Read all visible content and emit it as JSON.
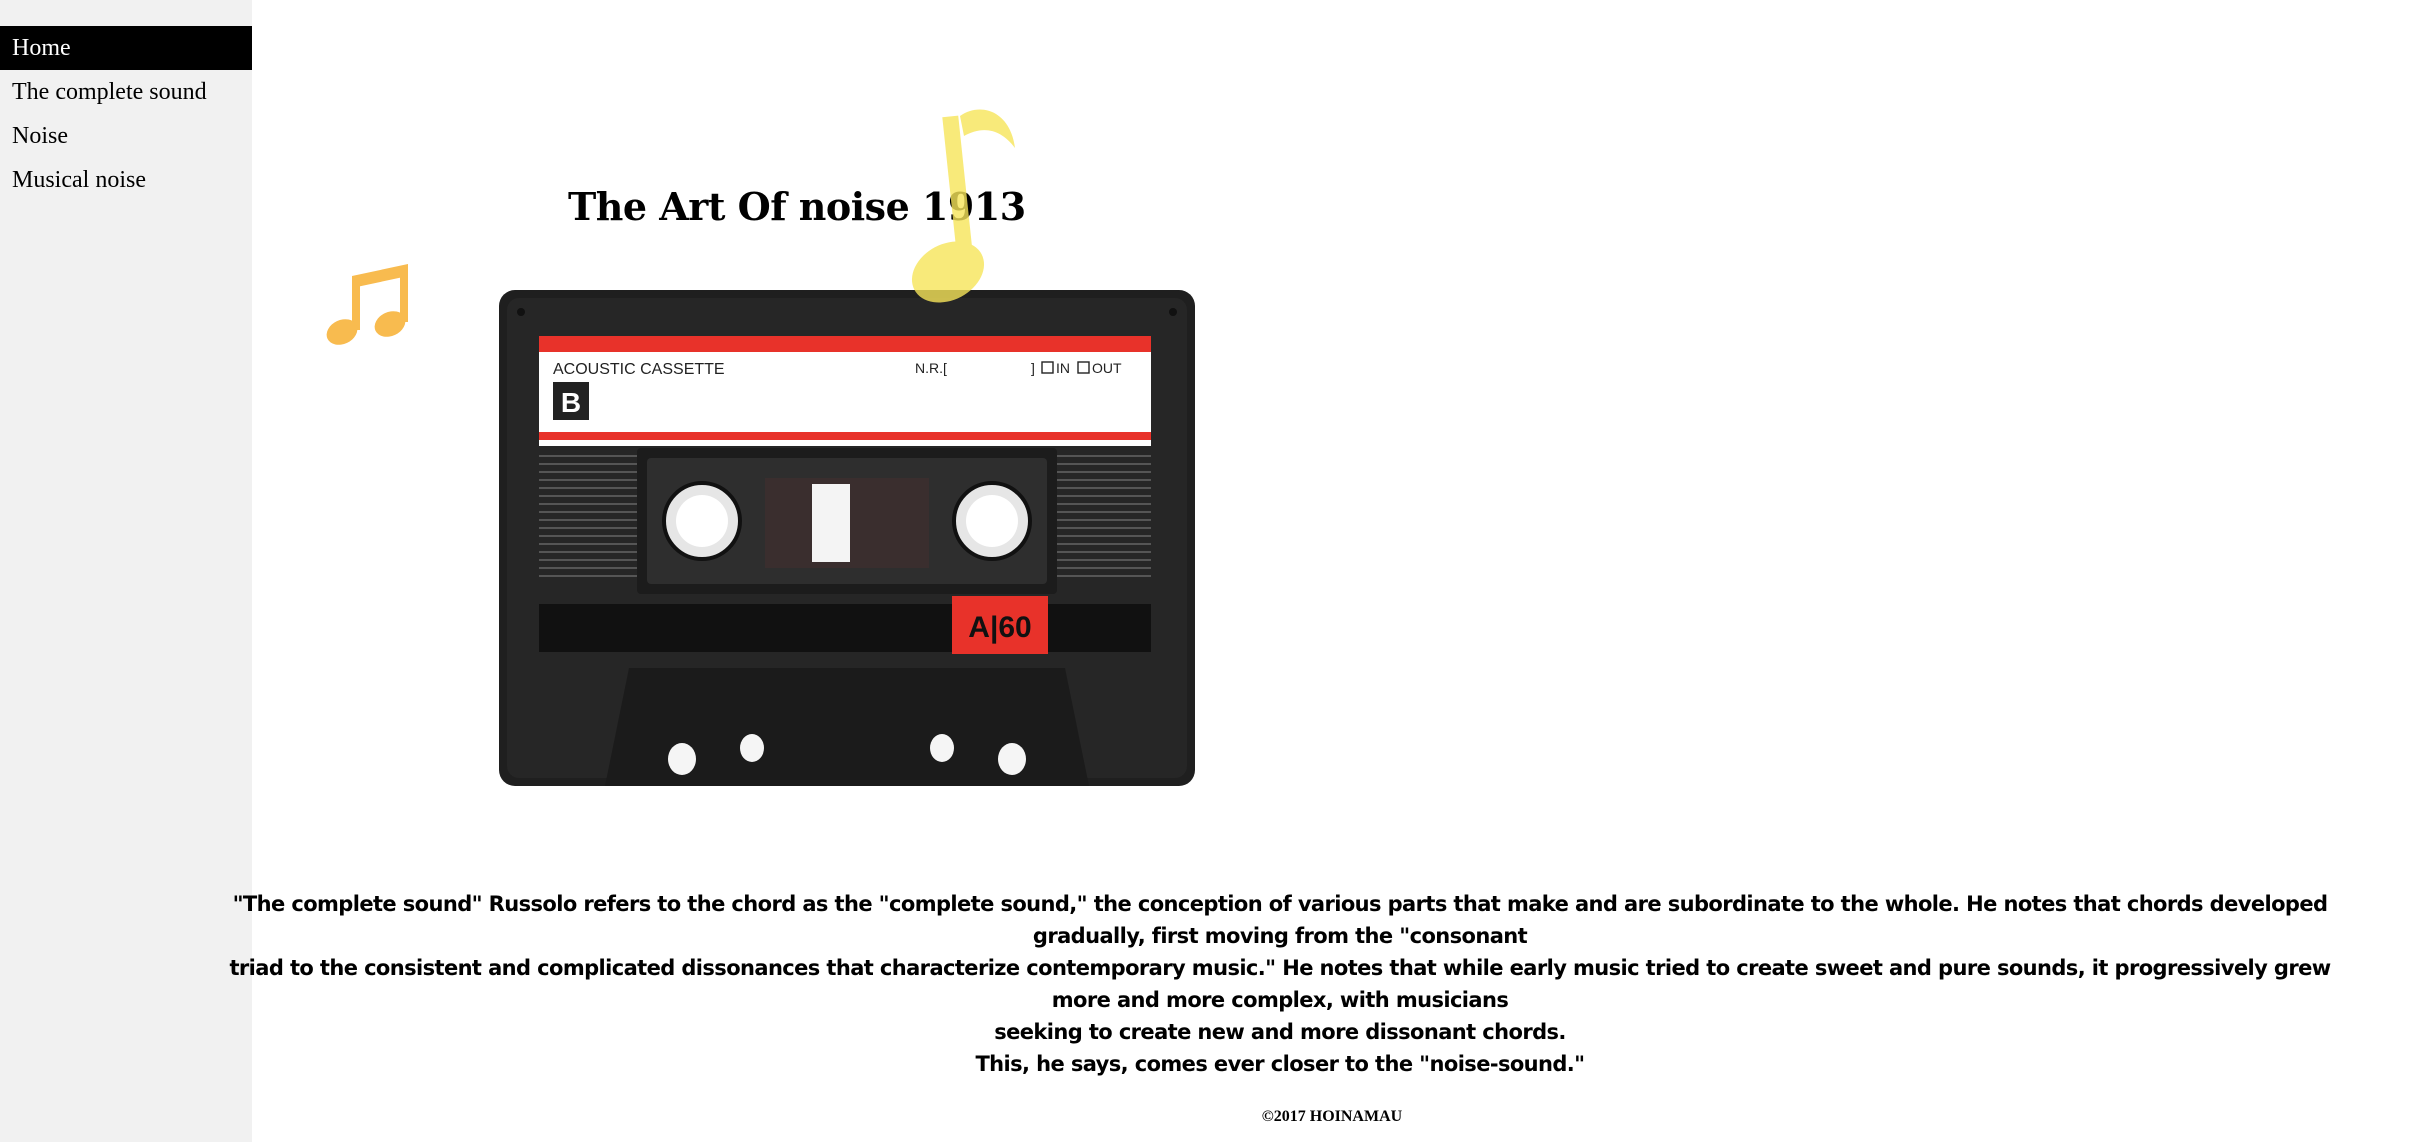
{
  "nav": {
    "items": [
      {
        "label": "Home",
        "active": true
      },
      {
        "label": "The complete sound",
        "active": false
      },
      {
        "label": "Noise",
        "active": false
      },
      {
        "label": "Musical noise",
        "active": false
      }
    ]
  },
  "main": {
    "title": "The Art Of noise 1913",
    "cassette": {
      "brand_text": "ACOUSTIC CASSETTE",
      "side": "B",
      "nr_label": "N.R.[",
      "nr_close": "]",
      "in_label": "IN",
      "out_label": "OUT",
      "length": "A|60"
    },
    "paragraph_lines": [
      "\"The complete sound\" Russolo refers to the chord as the \"complete sound,\" the conception of various parts that make and are subordinate to the whole. He notes that chords developed gradually, first moving from the \"consonant",
      "triad to the consistent and complicated dissonances that characterize contemporary music.\" He notes that while early music tried to create sweet and pure sounds, it progressively grew more and more complex, with musicians",
      "seeking to create new and more dissonant chords.",
      "This, he says, comes ever closer to the \"noise-sound.\""
    ]
  },
  "footer": {
    "text": "©2017 HOINAMAU"
  },
  "icons": {
    "yellow_note": "eighth-note-icon",
    "orange_note": "beamed-notes-icon"
  },
  "colors": {
    "sidebar_bg": "#f1f1f1",
    "active_nav_bg": "#000000",
    "yellow_note": "#f7e55a",
    "orange_note": "#f8bb4f",
    "cassette_red": "#e8322a"
  }
}
